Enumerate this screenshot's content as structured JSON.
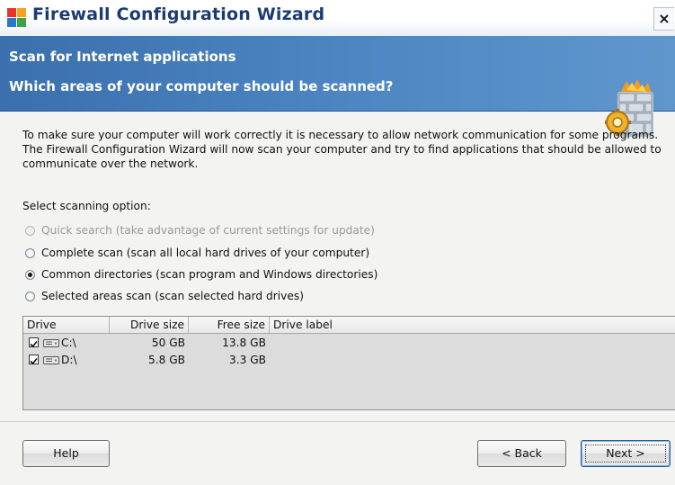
{
  "window": {
    "title": "Firewall Configuration Wizard",
    "close_glyph": "×",
    "app_icon": "avg-firewall-icon"
  },
  "banner": {
    "title": "Scan for Internet applications",
    "subtitle": "Which areas of your computer should be scanned?",
    "icon": "firewall-wall-gear-icon"
  },
  "description": "To make sure your computer will work correctly it is necessary to allow network communication for some programs. The Firewall Configuration Wizard will now scan your computer and try to find applications that should be allowed to communicate over the network.",
  "scan_options": {
    "label": "Select scanning option:",
    "selected": "Common directories (scan program and Windows directories)",
    "options": [
      {
        "label": "Quick search (take advantage of current settings for update)",
        "enabled": false,
        "checked": false
      },
      {
        "label": "Complete scan (scan all local hard drives of your computer)",
        "enabled": true,
        "checked": false
      },
      {
        "label": "Common directories (scan program and Windows directories)",
        "enabled": true,
        "checked": true
      },
      {
        "label": "Selected areas scan (scan selected hard drives)",
        "enabled": true,
        "checked": false
      }
    ]
  },
  "drives_table": {
    "columns": [
      "Drive",
      "Drive size",
      "Free size",
      "Drive label"
    ],
    "rows": [
      {
        "checked": true,
        "drive": "C:\\",
        "size": "50 GB",
        "free": "13.8 GB",
        "label": ""
      },
      {
        "checked": true,
        "drive": "D:\\",
        "size": "5.8 GB",
        "free": "3.3 GB",
        "label": ""
      }
    ]
  },
  "buttons": {
    "help": "Help",
    "back": "< Back",
    "next": "Next >"
  },
  "colors": {
    "banner": "#4a83c0",
    "title_text": "#1b3c73"
  }
}
